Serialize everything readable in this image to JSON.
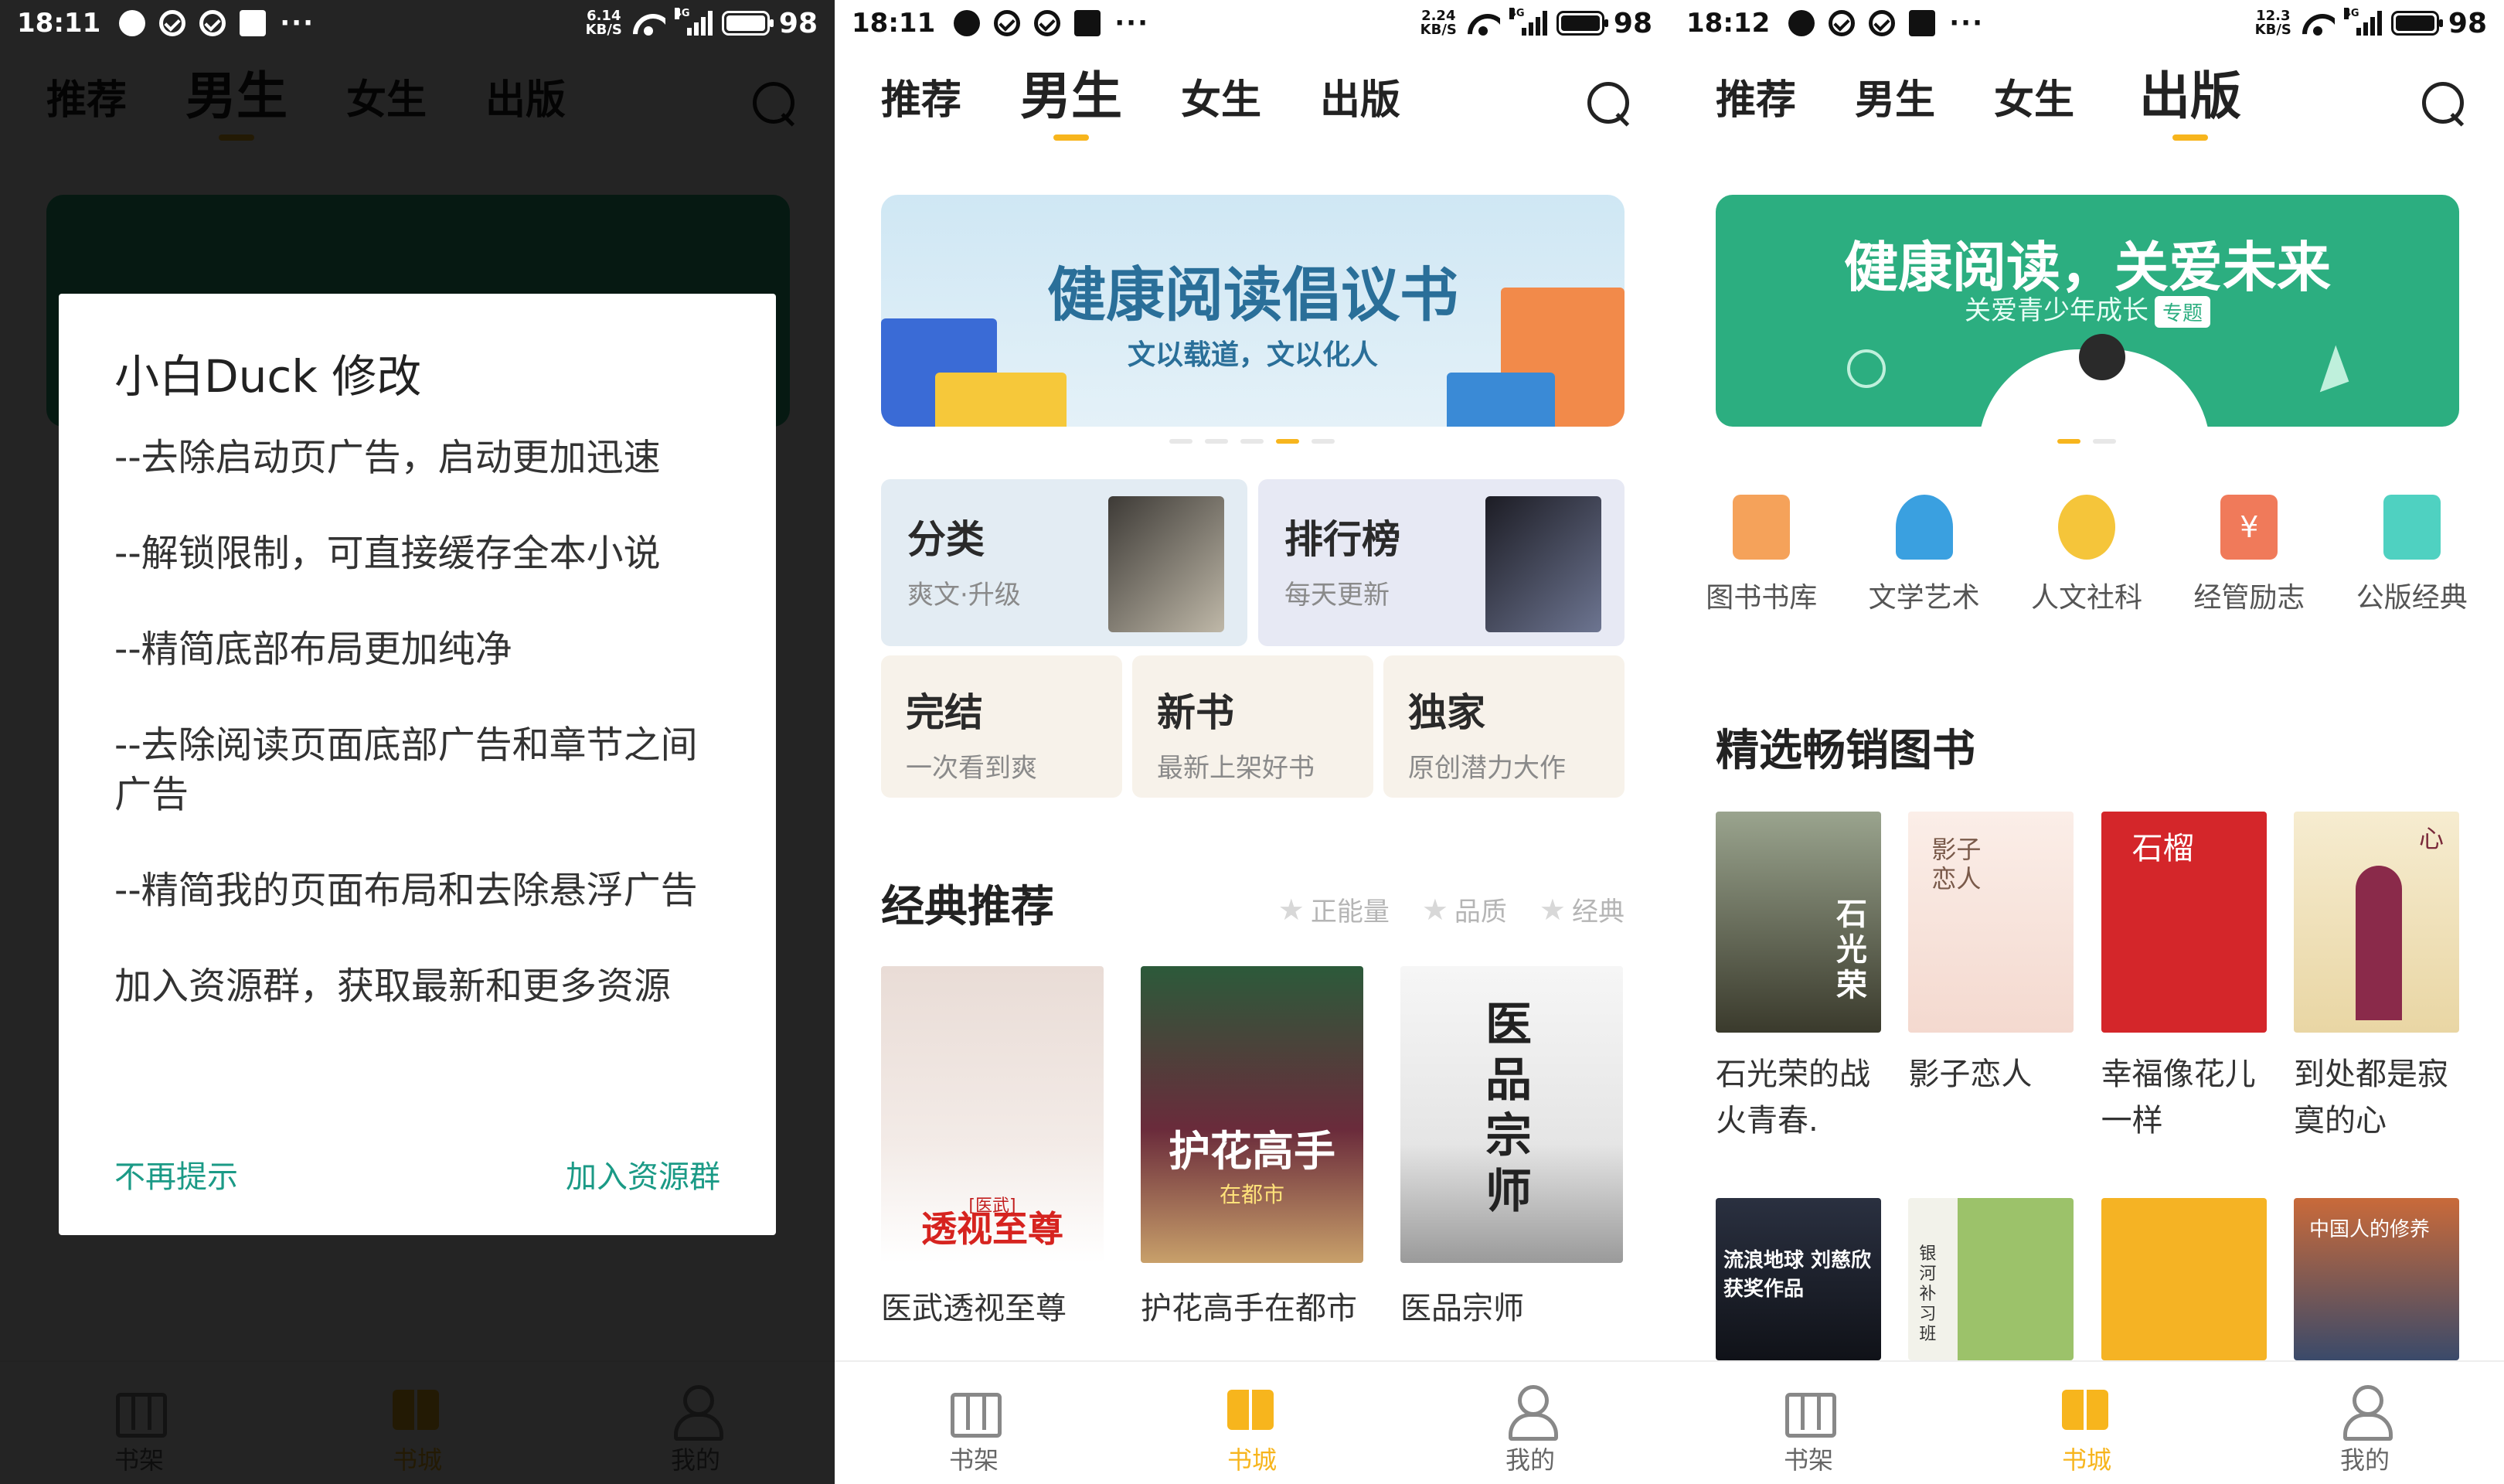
{
  "panels": [
    {
      "status": {
        "time": "18:11",
        "speed_top": "6.14",
        "speed_unit": "KB/S",
        "net": "4G",
        "battery": "98"
      },
      "tabs": [
        "推荐",
        "男生",
        "女生",
        "出版"
      ],
      "active_tab": "男生",
      "dialog": {
        "title": "小白Duck 修改",
        "lines": [
          "--去除启动页广告，启动更加迅速",
          "--解锁限制，可直接缓存全本小说",
          "--精简底部布局更加纯净",
          "--去除阅读页面底部广告和章节之间广告",
          "--精简我的页面布局和去除悬浮广告",
          "加入资源群，获取最新和更多资源"
        ],
        "cancel": "不再提示",
        "confirm": "加入资源群"
      },
      "bottom_nav": [
        "书架",
        "书城",
        "我的"
      ]
    },
    {
      "status": {
        "time": "18:11",
        "speed_top": "2.24",
        "speed_unit": "KB/S",
        "net": "4G",
        "battery": "98"
      },
      "tabs": [
        "推荐",
        "男生",
        "女生",
        "出版"
      ],
      "active_tab": "男生",
      "banner": {
        "title": "健康阅读倡议书",
        "subtitle": "文以载道，文以化人"
      },
      "tiles": [
        {
          "title": "分类",
          "sub": "爽文·升级"
        },
        {
          "title": "排行榜",
          "sub": "每天更新"
        },
        {
          "title": "完结",
          "sub": "一次看到爽"
        },
        {
          "title": "新书",
          "sub": "最新上架好书"
        },
        {
          "title": "独家",
          "sub": "原创潜力大作"
        }
      ],
      "section": "经典推荐",
      "filters": [
        "正能量",
        "品质",
        "经典"
      ],
      "books": [
        "医武透视至尊",
        "护花高手在都市",
        "医品宗师"
      ],
      "covers": [
        {
          "big": "透视至尊",
          "small": "[医武]"
        },
        {
          "big": "护花高手",
          "small": "在都市"
        },
        {
          "big": "医品宗师",
          "small": ""
        }
      ],
      "bottom_nav": [
        "书架",
        "书城",
        "我的"
      ],
      "accent": "#f7b51d"
    },
    {
      "status": {
        "time": "18:12",
        "speed_top": "12.3",
        "speed_unit": "KB/S",
        "net": "4G",
        "battery": "98"
      },
      "tabs": [
        "推荐",
        "男生",
        "女生",
        "出版"
      ],
      "active_tab": "出版",
      "banner": {
        "title": "健康阅读，关爱未来",
        "subtitle": "关爱青少年成长",
        "tag": "专题"
      },
      "categories": [
        {
          "label": "图书书库",
          "color": "#f5a25a"
        },
        {
          "label": "文学艺术",
          "color": "#3aa0e0"
        },
        {
          "label": "人文社科",
          "color": "#f5c53a"
        },
        {
          "label": "经管励志",
          "color": "#f07a5a"
        },
        {
          "label": "公版经典",
          "color": "#4fd1c1"
        }
      ],
      "section": "精选畅销图书",
      "best": [
        "石光荣的战火青春.",
        "影子恋人",
        "幸福像花儿一样",
        "到处都是寂寞的心"
      ],
      "best_covers": [
        "石光荣",
        "影子恋人",
        "石榴",
        "心"
      ],
      "second_row": [
        "流浪地球 刘慈欣获奖作品",
        "银河补习班",
        "",
        "中国人的修养"
      ],
      "bottom_nav": [
        "书架",
        "书城",
        "我的"
      ],
      "brand_green": "#2cae80"
    }
  ]
}
